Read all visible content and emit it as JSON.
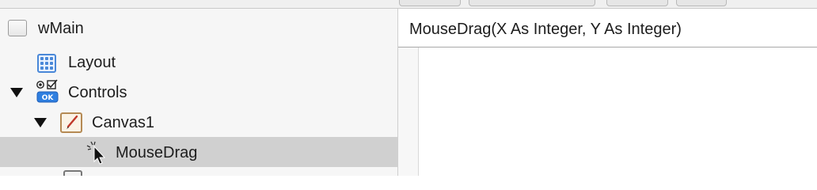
{
  "navigator": {
    "items": [
      {
        "label": "wMain",
        "icon": "window-icon"
      },
      {
        "label": "Layout",
        "icon": "layout-grid-icon"
      },
      {
        "label": "Controls",
        "icon": "controls-icon",
        "expanded": true
      },
      {
        "label": "Canvas1",
        "icon": "canvas-icon",
        "expanded": true
      },
      {
        "label": "MouseDrag",
        "icon": "mouse-cursor-icon",
        "selected": true
      }
    ]
  },
  "editor": {
    "signature": "MouseDrag(X As Integer, Y As Integer)"
  },
  "colors": {
    "selection": "#d0d0d0",
    "sidebar_background": "#f6f6f6",
    "layout_icon_blue": "#4a88d8",
    "ok_badge_blue": "#2f7fe0"
  }
}
